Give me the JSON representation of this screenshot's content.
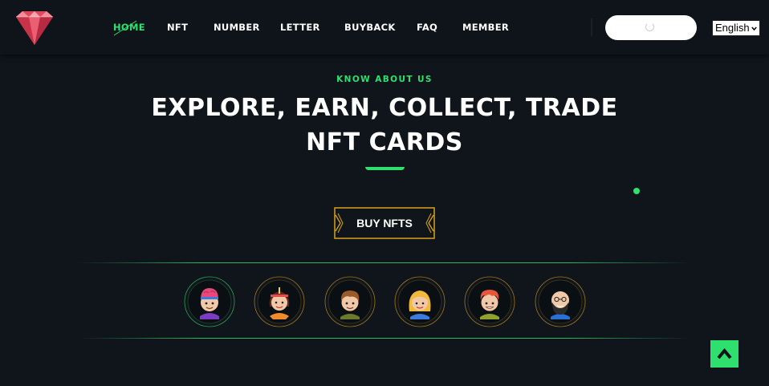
{
  "header": {
    "nav": [
      {
        "label": "HOME",
        "active": true
      },
      {
        "label": "NFT",
        "active": false
      },
      {
        "label": "NUMBER",
        "active": false
      },
      {
        "label": "LETTER",
        "active": false
      },
      {
        "label": "BUYBACK",
        "active": false
      },
      {
        "label": "FAQ",
        "active": false
      },
      {
        "label": "MEMBER",
        "active": false
      }
    ],
    "wallet_button": {
      "state": "loading",
      "icon": "spinner-icon"
    },
    "language": {
      "selected": "English"
    },
    "logo_icon": "ruby-diamond-logo"
  },
  "hero": {
    "eyebrow": "KNOW ABOUT US",
    "headline_line1": "EXPLORE, EARN, COLLECT, TRADE",
    "headline_line2": "NFT CARDS",
    "cta_label": "BUY NFTS"
  },
  "avatars": [
    {
      "icon": "avatar-brain-head-icon",
      "ring": "green"
    },
    {
      "icon": "avatar-girl-headband-icon",
      "ring": "gold"
    },
    {
      "icon": "avatar-brown-hair-boy-icon",
      "ring": "gold"
    },
    {
      "icon": "avatar-blonde-girl-icon",
      "ring": "gold"
    },
    {
      "icon": "avatar-red-hair-boy-icon",
      "ring": "gold"
    },
    {
      "icon": "avatar-bald-beard-man-icon",
      "ring": "gold"
    }
  ],
  "scroll_top": {
    "icon": "chevron-up-icon"
  },
  "colors": {
    "background": "#0f151a",
    "accent": "#2ee06e",
    "gold": "#d9a21b",
    "ruby": "#e0475b"
  }
}
